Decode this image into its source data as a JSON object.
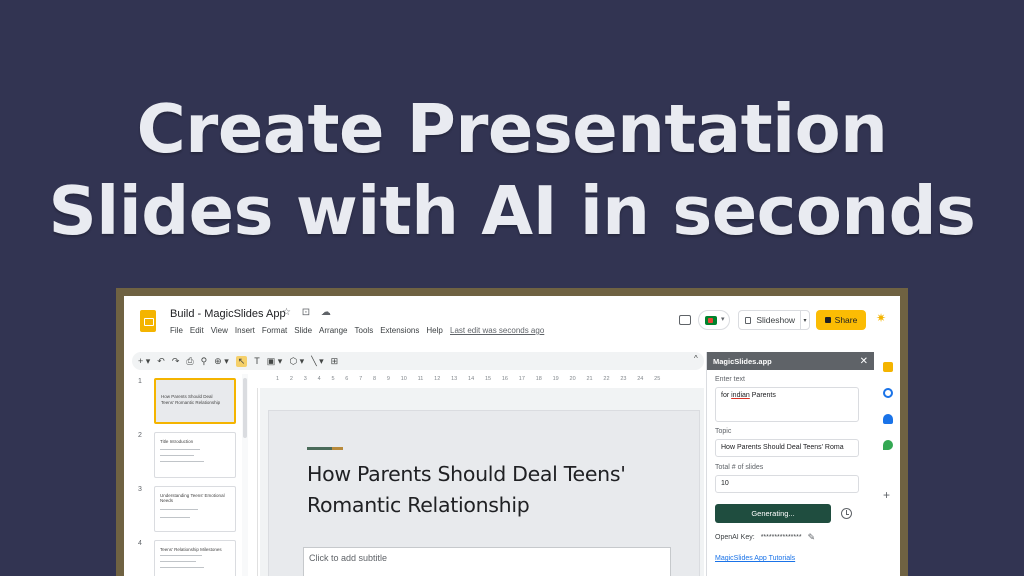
{
  "headline": {
    "line1": "Create Presentation",
    "line2": "Slides with AI in seconds"
  },
  "app": {
    "doc_title": "Build - MagicSlides App",
    "title_icons": "☆ ⊡ ☁",
    "menu": [
      "File",
      "Edit",
      "View",
      "Insert",
      "Format",
      "Slide",
      "Arrange",
      "Tools",
      "Extensions",
      "Help"
    ],
    "last_edit": "Last edit was seconds ago",
    "slideshow_label": "Slideshow",
    "share_label": "Share",
    "toolbar": {
      "add": "+ ▾",
      "undo": "↶",
      "redo": "↷",
      "print": "⎙",
      "paint": "⚲",
      "zoom": "⊕ ▾",
      "select": "↖",
      "textbox": "T",
      "image": "▣ ▾",
      "shape": "⬡ ▾",
      "line": "╲ ▾",
      "comment": "⊞"
    },
    "collapse": "^",
    "ruler_ticks": [
      "1",
      "2",
      "3",
      "4",
      "5",
      "6",
      "7",
      "8",
      "9",
      "10",
      "11",
      "12",
      "13",
      "14",
      "15",
      "16",
      "17",
      "18",
      "19",
      "20",
      "21",
      "22",
      "23",
      "24",
      "25"
    ]
  },
  "filmstrip": [
    {
      "num": "1",
      "title": "How Parents Should Deal",
      "title2": "Teens' Romantic Relationship"
    },
    {
      "num": "2",
      "title": "Title Introduction",
      "title2": ""
    },
    {
      "num": "3",
      "title": "Understanding Teens' Emotional",
      "title2": "Needs"
    },
    {
      "num": "4",
      "title": "Teens' Relationship Milestones",
      "title2": ""
    }
  ],
  "slide": {
    "title": "How Parents Should Deal Teens' Romantic Relationship",
    "subtitle_placeholder": "Click to add subtitle"
  },
  "panel": {
    "header": "MagicSlides.app",
    "close": "✕",
    "enter_text_label": "Enter text",
    "enter_text_value_pre": "for ",
    "enter_text_value_word": "indian",
    "enter_text_value_post": " Parents",
    "topic_label": "Topic",
    "topic_value": "How Parents Should Deal Teens' Roma",
    "total_label": "Total # of slides",
    "total_value": "10",
    "generate_label": "Generating...",
    "key_label": "OpenAI Key:",
    "key_value": "***************",
    "edit_icon": "✎",
    "tutorials_link": "MagicSlides App Tutorials"
  },
  "colors": {
    "background": "#323452",
    "frame": "#6f6242",
    "share": "#fbbc04",
    "generate": "#1f4d3f"
  }
}
